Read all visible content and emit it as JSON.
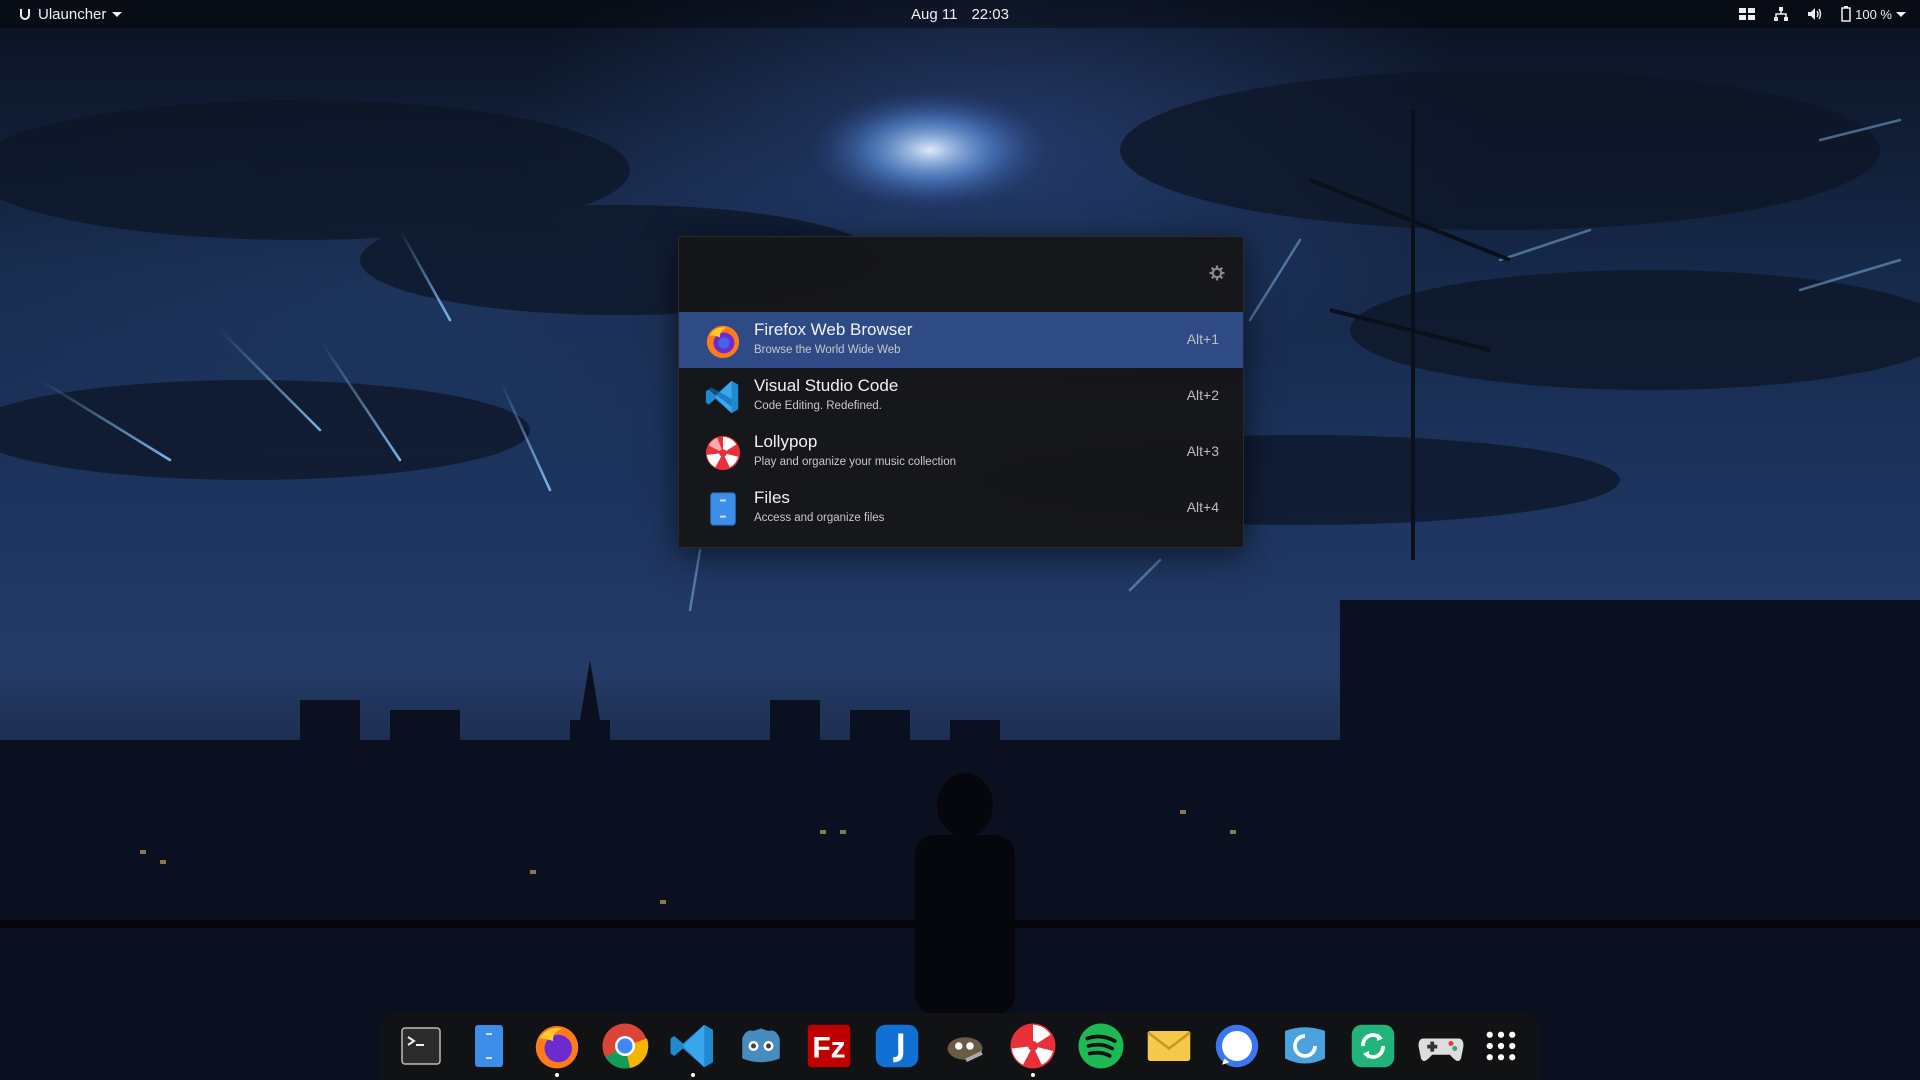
{
  "topbar": {
    "app_menu_label": "Ulauncher",
    "date": "Aug 11",
    "time": "22:03",
    "battery_percent": "100 %"
  },
  "launcher": {
    "search_value": "",
    "results": [
      {
        "title": "Firefox Web Browser",
        "subtitle": "Browse the World Wide Web",
        "shortcut": "Alt+1",
        "icon": "firefox-icon",
        "selected": true
      },
      {
        "title": "Visual Studio Code",
        "subtitle": "Code Editing. Redefined.",
        "shortcut": "Alt+2",
        "icon": "vscode-icon",
        "selected": false
      },
      {
        "title": "Lollypop",
        "subtitle": "Play and organize your music collection",
        "shortcut": "Alt+3",
        "icon": "lollypop-icon",
        "selected": false
      },
      {
        "title": "Files",
        "subtitle": "Access and organize files",
        "shortcut": "Alt+4",
        "icon": "files-icon",
        "selected": false
      }
    ]
  },
  "dock": {
    "items": [
      {
        "name": "terminal-icon",
        "running": false
      },
      {
        "name": "files-icon",
        "running": false
      },
      {
        "name": "firefox-icon",
        "running": true
      },
      {
        "name": "chrome-icon",
        "running": false
      },
      {
        "name": "vscode-icon",
        "running": true
      },
      {
        "name": "godot-icon",
        "running": false
      },
      {
        "name": "filezilla-icon",
        "running": false
      },
      {
        "name": "joplin-icon",
        "running": false
      },
      {
        "name": "gimp-icon",
        "running": false
      },
      {
        "name": "lollypop-icon",
        "running": true
      },
      {
        "name": "spotify-icon",
        "running": false
      },
      {
        "name": "mail-icon",
        "running": false
      },
      {
        "name": "signal-icon",
        "running": false
      },
      {
        "name": "vpn-icon",
        "running": false
      },
      {
        "name": "sync-icon",
        "running": false
      },
      {
        "name": "gamepad-icon",
        "running": false
      },
      {
        "name": "app-grid-icon",
        "running": false
      }
    ]
  },
  "colors": {
    "selection": "#2e4b86",
    "launcher_bg": "#161618",
    "dock_bg": "#121214"
  }
}
